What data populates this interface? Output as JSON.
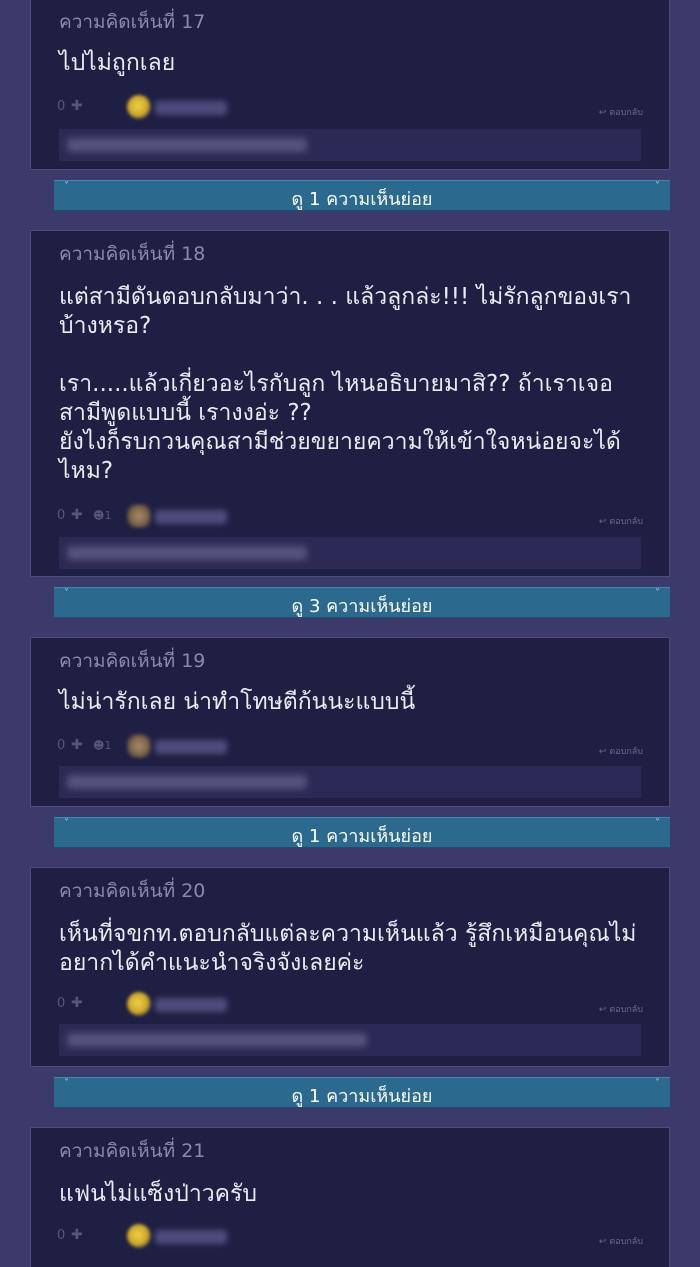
{
  "comments": [
    {
      "header": "ความคิดเห็นที่ 17",
      "body": "ไปไม่ถูกเลย",
      "score": "0",
      "emotion": "",
      "avatar": "yellow",
      "reply_label": "ตอบกลับ",
      "reply_placeholder": "ร่วมแสดงความคิดเห็น"
    },
    {
      "header": "ความคิดเห็นที่ 18",
      "body": "แต่สามีดันตอบกลับมาว่า. . . แล้วลูกล่ะ!!! ไม่รักลูกของเราบ้างหรอ?\n\nเรา.....แล้วเกี่ยวอะไรกับลูก ไหนอธิบายมาสิ?? ถ้าเราเจอสามีพูดแบบนี้ เรางงอ่ะ ??\nยังไงก็รบกวนคุณสามีช่วยขยายความให้เข้าใจหน่อยจะได้ไหม?",
      "score": "0",
      "emotion": "1",
      "avatar": "brown",
      "reply_label": "ตอบกลับ",
      "reply_placeholder": "ร่วมแสดงความคิดเห็น"
    },
    {
      "header": "ความคิดเห็นที่ 19",
      "body": "ไม่น่ารักเลย น่าทำโทษตีก้นนะแบบนี้",
      "score": "0",
      "emotion": "1",
      "avatar": "brown",
      "reply_label": "ตอบกลับ",
      "reply_placeholder": "ร่วมแสดงความคิดเห็น"
    },
    {
      "header": "ความคิดเห็นที่ 20",
      "body": "เห็นที่จขกท.ตอบกลับแต่ละความเห็นแล้ว รู้สึกเหมือนคุณไม่อยากได้คำแนะนำจริงจังเลยค่ะ",
      "score": "0",
      "emotion": "",
      "avatar": "yellow",
      "reply_label": "ตอบกลับ",
      "reply_placeholder": "พื้นที่แสดงความคิดเห็น"
    },
    {
      "header": "ความคิดเห็นที่ 21",
      "body": "แฟนไม่แซ็งป่าวครับ",
      "score": "0",
      "emotion": "",
      "avatar": "yellow",
      "reply_label": "ตอบกลับ",
      "reply_placeholder": ""
    }
  ],
  "expanders": [
    {
      "label": "ดู 1 ความเห็นย่อย",
      "chevron": "˅"
    },
    {
      "label": "ดู 3 ความเห็นย่อย",
      "chevron": "˅"
    },
    {
      "label": "ดู 1 ความเห็นย่อย",
      "chevron": "˅"
    },
    {
      "label": "ดู 1 ความเห็นย่อย",
      "chevron": "˅"
    }
  ],
  "icons": {
    "plus": "✚",
    "emotion": "☻",
    "reply": "↩"
  },
  "colors": {
    "page_bg": "#3b3a6a",
    "card_bg": "#1f1f44",
    "expander_bg": "#2b6a8e"
  }
}
